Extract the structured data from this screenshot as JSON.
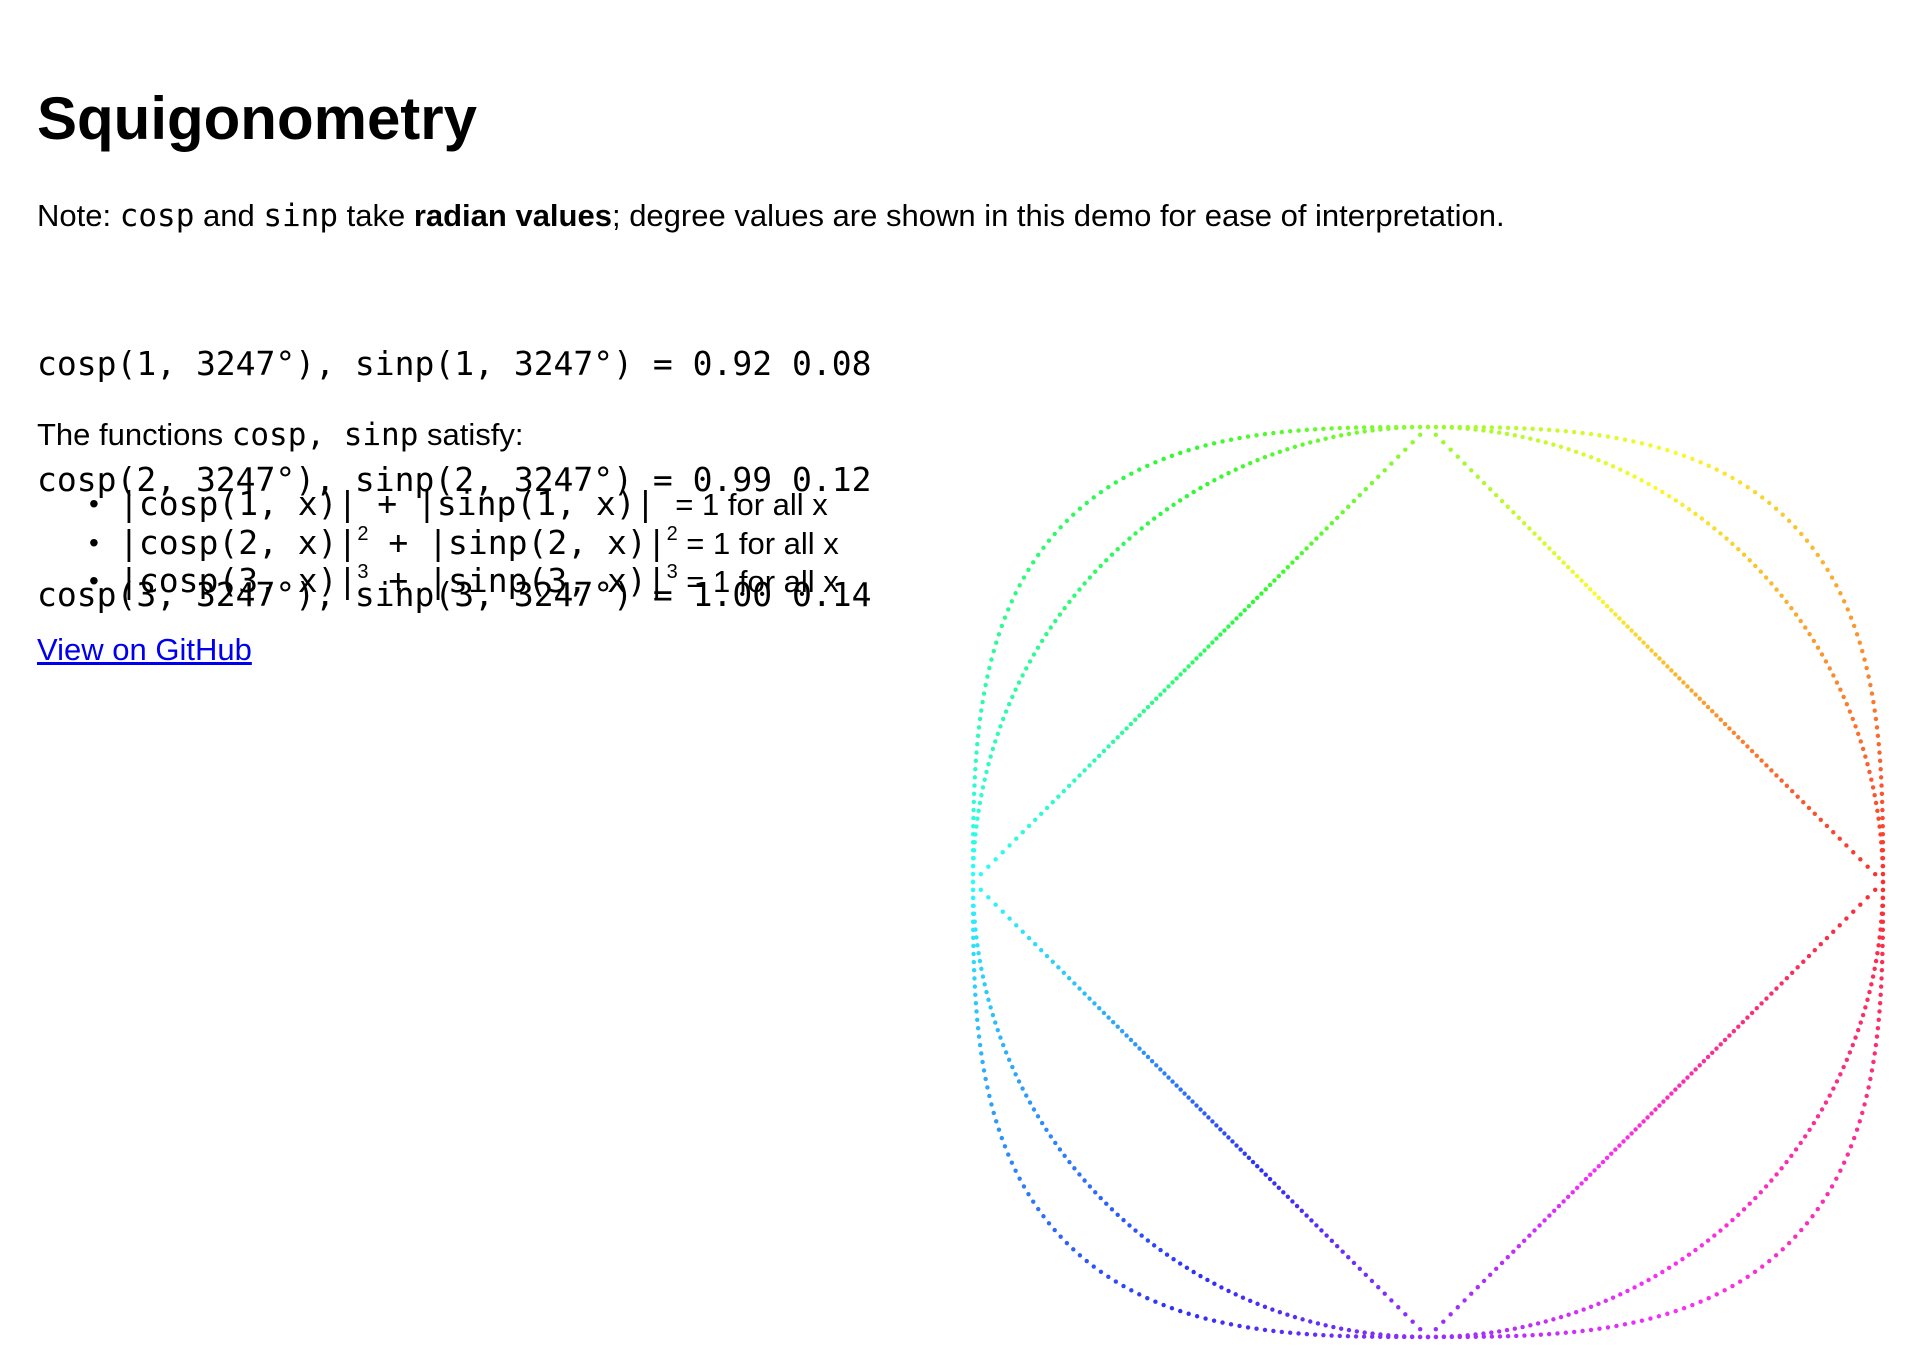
{
  "title": "Squigonometry",
  "note": {
    "prefix": "Note: ",
    "cosp": "cosp",
    "and": " and ",
    "sinp": "sinp",
    "take": " take ",
    "bold": "radian values",
    "suffix": "; degree values are shown in this demo for ease of interpretation."
  },
  "values": [
    "cosp(1, 3247°), sinp(1, 3247°) = 0.92 0.08",
    "cosp(2, 3247°), sinp(2, 3247°) = 0.99 0.12",
    "cosp(3, 3247°), sinp(3, 3247°) = 1.00 0.14"
  ],
  "satisfy": {
    "prefix": "The functions ",
    "code": "cosp, sinp",
    "suffix": " satisfy:"
  },
  "identities": [
    {
      "expr_a": "|cosp(1, x)| ",
      "exp_a": "",
      "expr_b": " + |sinp(1, x)| ",
      "exp_b": "",
      "tail": " = 1 for all x"
    },
    {
      "expr_a": "|cosp(2, x)|",
      "exp_a": "2",
      "expr_b": " + |sinp(2, x)|",
      "exp_b": "2",
      "tail": " = 1 for all x"
    },
    {
      "expr_a": "|cosp(3, x)|",
      "exp_a": "3",
      "expr_b": " + |sinp(3, x)|",
      "exp_b": "3",
      "tail": " = 1 for all x"
    }
  ],
  "github_link": "View on GitHub",
  "plot_curves": [
    {
      "p": 1
    },
    {
      "p": 2
    },
    {
      "p": 3
    }
  ],
  "link_color": "#0000ee"
}
